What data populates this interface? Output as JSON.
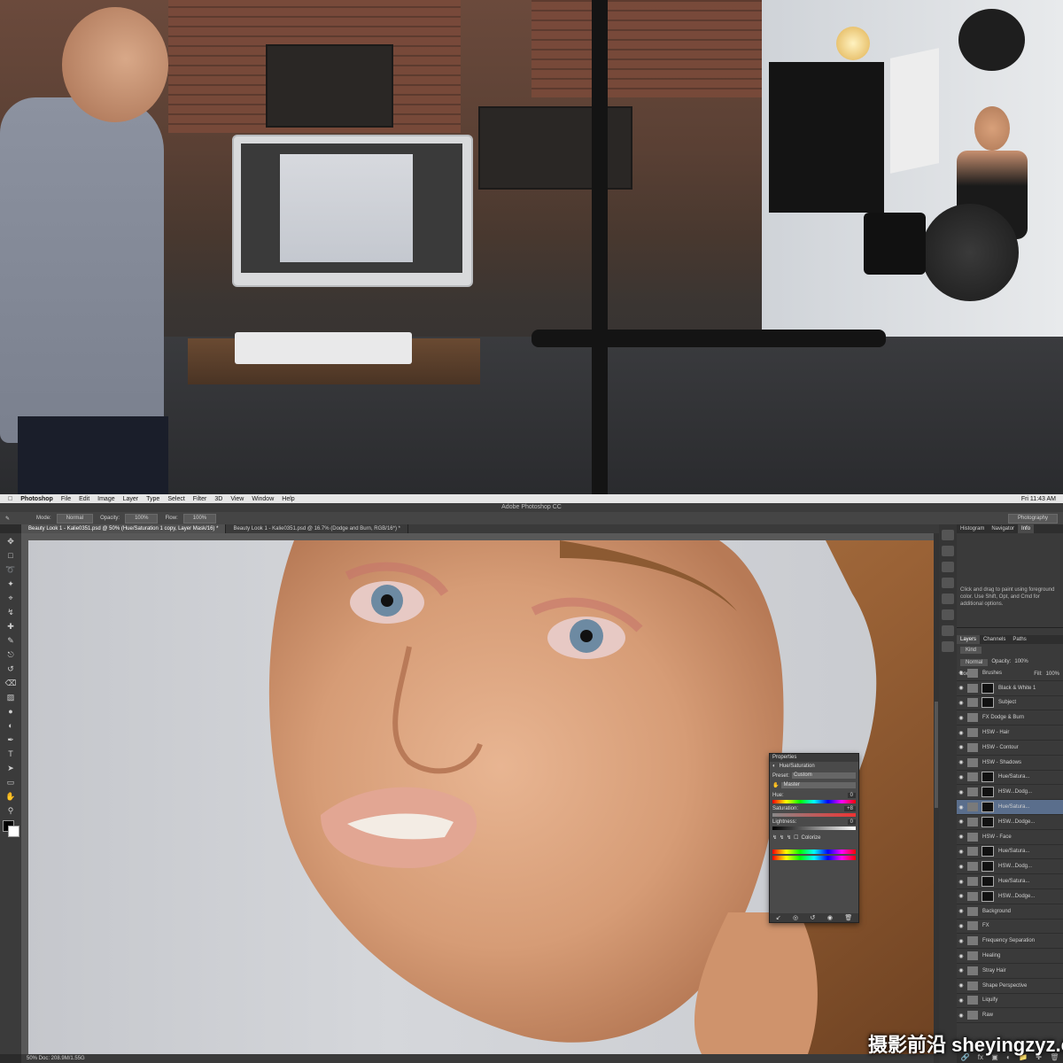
{
  "menubar": {
    "app": "Photoshop",
    "items": [
      "File",
      "Edit",
      "Image",
      "Layer",
      "Type",
      "Select",
      "Filter",
      "3D",
      "View",
      "Window",
      "Help"
    ],
    "clock": "Fri 11:43 AM"
  },
  "window_title": "Adobe Photoshop CC",
  "options_bar": {
    "mode_label": "Mode:",
    "mode_value": "Normal",
    "opacity_label": "Opacity:",
    "opacity_value": "100%",
    "flow_label": "Flow:",
    "flow_value": "100%",
    "workspace": "Photography"
  },
  "document_tabs": [
    "Beauty Look 1 - Kalie0351.psd @ 50% (Hue/Saturation 1 copy, Layer Mask/16) *",
    "Beauty Look 1 - Kalie0351.psd @ 16.7% (Dodge and Burn, RGB/16*) *"
  ],
  "status_bar": "50%      Doc: 208.9M/1.55G",
  "right_panel": {
    "top_tabs": [
      "Histogram",
      "Navigator",
      "Info"
    ],
    "info_desc": "Click and drag to paint using foreground color. Use Shift, Opt, and Cmd for additional options.",
    "layer_tabs": [
      "Layers",
      "Channels",
      "Paths"
    ],
    "kind_label": "Kind",
    "blend_mode": "Normal",
    "opacity_label": "Opacity:",
    "opacity_value": "100%",
    "lock_label": "Lock:",
    "fill_label": "Fill:",
    "fill_value": "100%",
    "layers": [
      {
        "name": "Brushes",
        "mask": false,
        "selected": false
      },
      {
        "name": "Black & White 1",
        "mask": true,
        "selected": false
      },
      {
        "name": "Subject",
        "mask": true,
        "selected": false
      },
      {
        "name": "FX Dodge & Burn",
        "mask": false,
        "selected": false
      },
      {
        "name": "HSW - Hair",
        "mask": false,
        "selected": false
      },
      {
        "name": "HSW - Contour",
        "mask": false,
        "selected": false
      },
      {
        "name": "HSW - Shadows",
        "mask": false,
        "selected": false
      },
      {
        "name": "Hue/Satura...",
        "mask": true,
        "selected": false
      },
      {
        "name": "HSW...Dodg...",
        "mask": true,
        "selected": false
      },
      {
        "name": "Hue/Satura...",
        "mask": true,
        "selected": true
      },
      {
        "name": "HSW...Dodge...",
        "mask": true,
        "selected": false
      },
      {
        "name": "HSW - Face",
        "mask": false,
        "selected": false
      },
      {
        "name": "Hue/Satura...",
        "mask": true,
        "selected": false
      },
      {
        "name": "HSW...Dodg...",
        "mask": true,
        "selected": false
      },
      {
        "name": "Hue/Satura...",
        "mask": true,
        "selected": false
      },
      {
        "name": "HSW...Dodge...",
        "mask": true,
        "selected": false
      },
      {
        "name": "Background",
        "mask": false,
        "selected": false
      },
      {
        "name": "FX",
        "mask": false,
        "selected": false
      },
      {
        "name": "Frequency Separation",
        "mask": false,
        "selected": false
      },
      {
        "name": "Healing",
        "mask": false,
        "selected": false
      },
      {
        "name": "Stray Hair",
        "mask": false,
        "selected": false
      },
      {
        "name": "Shape Perspective",
        "mask": false,
        "selected": false
      },
      {
        "name": "Liquify",
        "mask": false,
        "selected": false
      },
      {
        "name": "Raw",
        "mask": false,
        "selected": false
      }
    ]
  },
  "properties": {
    "header": "Properties",
    "title": "Hue/Saturation",
    "preset_label": "Preset:",
    "preset_value": "Custom",
    "channel_value": "Master",
    "hue_label": "Hue:",
    "hue_value": "0",
    "saturation_label": "Saturation:",
    "saturation_value": "+8",
    "lightness_label": "Lightness:",
    "lightness_value": "0",
    "colorize_label": "Colorize"
  },
  "watermark": "摄影前沿 sheyingzyz.com",
  "colors": {
    "ps_bg": "#2b2b2b",
    "panel": "#3a3a3a",
    "selected_layer": "#5a6e8c",
    "menubar": "#e6e6e6",
    "canvas_bg": "#c8cacf"
  },
  "icons": {
    "tools": [
      "move-tool-icon",
      "marquee-tool-icon",
      "lasso-tool-icon",
      "quick-select-tool-icon",
      "crop-tool-icon",
      "eyedropper-tool-icon",
      "healing-brush-icon",
      "brush-tool-icon",
      "clone-stamp-icon",
      "history-brush-icon",
      "eraser-tool-icon",
      "gradient-tool-icon",
      "blur-tool-icon",
      "dodge-tool-icon",
      "pen-tool-icon",
      "type-tool-icon",
      "path-select-icon",
      "shape-tool-icon",
      "hand-tool-icon",
      "zoom-tool-icon"
    ]
  }
}
